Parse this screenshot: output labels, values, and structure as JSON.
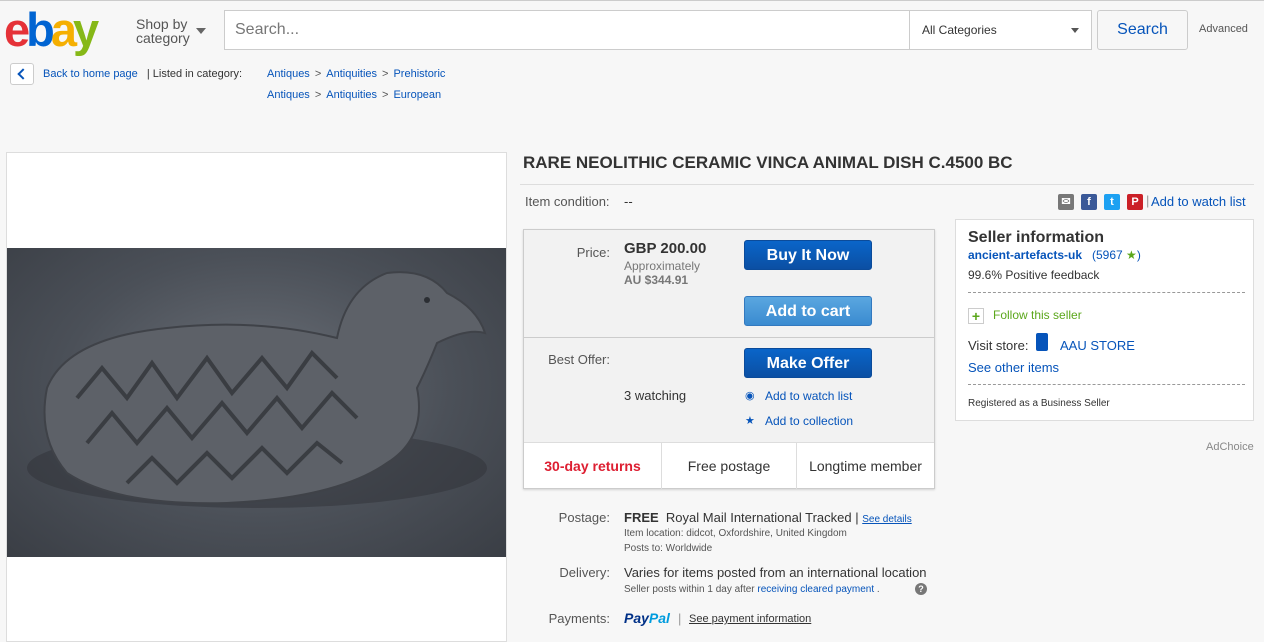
{
  "header": {
    "logo_letters": {
      "e": "e",
      "b": "b",
      "a": "a",
      "y": "y"
    },
    "shop_by_line1": "Shop by",
    "shop_by_line2": "category",
    "search_placeholder": "Search...",
    "category_selected": "All Categories",
    "search_button": "Search",
    "advanced_link": "Advanced"
  },
  "breadcrumb": {
    "back_label": "Back to home page",
    "listed_label": "| Listed in category:",
    "path1": [
      "Antiques",
      "Antiquities",
      "Prehistoric"
    ],
    "path2": [
      "Antiques",
      "Antiquities",
      "European"
    ],
    "separator": ">"
  },
  "item": {
    "title": "RARE NEOLITHIC CERAMIC VINCA ANIMAL DISH C.4500 BC",
    "condition_label": "Item condition:",
    "condition_value": "--",
    "add_to_watch_list": "Add to watch list",
    "share_icons": [
      "email-icon",
      "facebook-icon",
      "twitter-icon",
      "pinterest-icon"
    ],
    "share_separator": "|"
  },
  "buybox": {
    "price_label": "Price:",
    "price": "GBP 200.00",
    "approx_label": "Approximately",
    "approx_value": "AU $344.91",
    "buy_now": "Buy It Now",
    "add_to_cart": "Add to cart",
    "best_offer_label": "Best Offer:",
    "make_offer": "Make Offer",
    "watching": "3 watching",
    "add_to_watch_list": "Add to watch list",
    "add_to_collection": "Add to collection",
    "returns": "30-day returns",
    "free_postage": "Free postage",
    "longtime": "Longtime member"
  },
  "seller": {
    "heading": "Seller information",
    "name": "ancient-artefacts-uk",
    "score": "(5967",
    "score_close": ")",
    "feedback": "99.6% Positive feedback",
    "follow": "Follow this seller",
    "visit_store_label": "Visit store:",
    "store_name": "AAU STORE",
    "see_other": "See other items",
    "registered": "Registered as a Business Seller"
  },
  "adchoice": "AdChoice",
  "details": {
    "postage_label": "Postage:",
    "postage_free": "FREE",
    "postage_service": "Royal Mail International Tracked |",
    "see_details": "See details",
    "item_location": "Item location:  didcot, Oxfordshire, United Kingdom",
    "posts_to": "Posts to:  Worldwide",
    "delivery_label": "Delivery:",
    "delivery_text": "Varies for items posted from an international location",
    "delivery_small_prefix": "Seller posts within 1 day after",
    "delivery_small_link": "receiving cleared payment",
    "delivery_small_suffix": ".",
    "payments_label": "Payments:",
    "paypal_part1": "Pay",
    "paypal_part2": "Pal",
    "paypal_separator": "|",
    "see_payment": "See payment information"
  },
  "colors": {
    "ebay_red": "#e53238",
    "ebay_blue": "#0064d2",
    "ebay_yellow": "#f5af02",
    "ebay_green": "#86b817",
    "link_blue": "#0654ba",
    "returns_red": "#dd1e31"
  }
}
